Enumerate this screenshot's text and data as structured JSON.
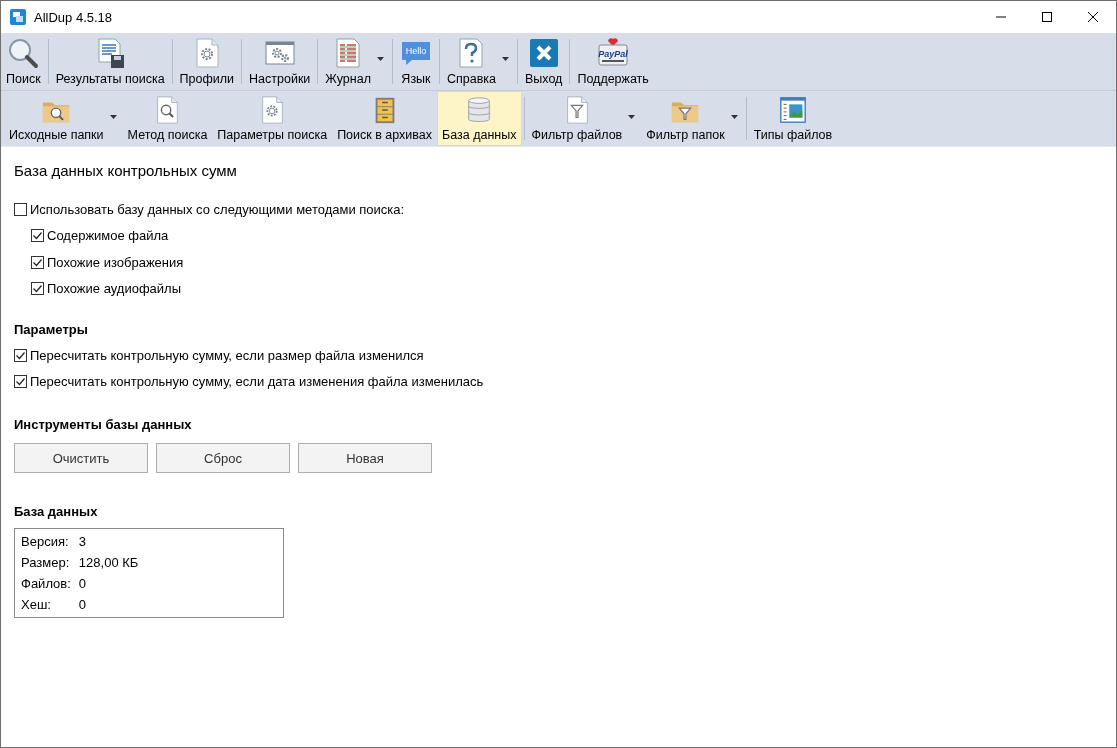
{
  "window": {
    "title": "AllDup 4.5.18"
  },
  "toolbar_main": [
    {
      "label": "Поиск",
      "dropdown": false
    },
    {
      "label": "Результаты поиска",
      "dropdown": false
    },
    {
      "label": "Профили",
      "dropdown": false
    },
    {
      "label": "Настройки",
      "dropdown": false
    },
    {
      "label": "Журнал",
      "dropdown": true
    },
    {
      "label": "Язык",
      "dropdown": false,
      "icon_text": "Hello"
    },
    {
      "label": "Справка",
      "dropdown": true
    },
    {
      "label": "Выход",
      "dropdown": false
    },
    {
      "label": "Поддержать",
      "dropdown": false,
      "icon_text": "PayPal"
    }
  ],
  "toolbar_sections": [
    {
      "items": [
        {
          "label": "Исходные папки",
          "dropdown": true,
          "selected": false
        },
        {
          "label": "Метод поиска",
          "dropdown": false,
          "selected": false
        },
        {
          "label": "Параметры поиска",
          "dropdown": false,
          "selected": false
        },
        {
          "label": "Поиск в архивах",
          "dropdown": false,
          "selected": false
        },
        {
          "label": "База данных",
          "dropdown": false,
          "selected": true
        }
      ]
    },
    {
      "items": [
        {
          "label": "Фильтр файлов",
          "dropdown": true,
          "selected": false
        },
        {
          "label": "Фильтр папок",
          "dropdown": true,
          "selected": false
        }
      ]
    },
    {
      "items": [
        {
          "label": "Типы файлов",
          "dropdown": false,
          "selected": false
        }
      ]
    }
  ],
  "panel": {
    "title": "База данных контрольных сумм",
    "use_database": {
      "label": "Использовать базу данных со следующими методами поиска:",
      "checked": false
    },
    "methods": [
      {
        "label": "Содержимое файла",
        "checked": true
      },
      {
        "label": "Похожие изображения",
        "checked": true
      },
      {
        "label": "Похожие аудиофайлы",
        "checked": true
      }
    ],
    "parameters": {
      "heading": "Параметры",
      "options": [
        {
          "label": "Пересчитать контрольную сумму, если размер файла изменился",
          "checked": true
        },
        {
          "label": "Пересчитать контрольную сумму, если дата изменения файла изменилась",
          "checked": true
        }
      ]
    },
    "tools": {
      "heading": "Инструменты базы данных",
      "buttons": [
        "Очистить",
        "Сброс",
        "Новая"
      ]
    },
    "database": {
      "heading": "База данных",
      "fields": [
        {
          "label": "Версия:",
          "value": "3"
        },
        {
          "label": "Размер:",
          "value": "128,00 КБ"
        },
        {
          "label": "Файлов:",
          "value": "0"
        },
        {
          "label": "Хеш:",
          "value": "0"
        }
      ]
    }
  }
}
